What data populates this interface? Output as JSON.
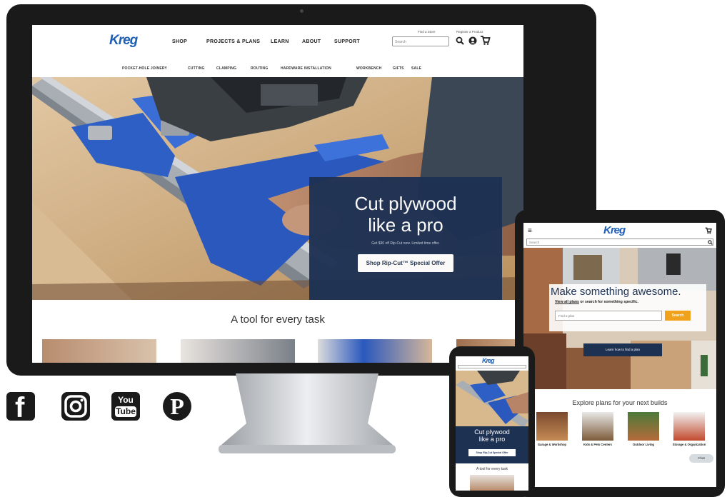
{
  "desktop": {
    "logo": "Kreg",
    "nav": [
      "SHOP",
      "PROJECTS & PLANS",
      "LEARN",
      "ABOUT",
      "SUPPORT"
    ],
    "util_links": [
      "Find a Store",
      "Register a Product"
    ],
    "search_placeholder": "Search",
    "subnav": [
      "POCKET-HOLE JOINERY",
      "CUTTING",
      "CLAMPING",
      "ROUTING",
      "HARDWARE INSTALLATION",
      "WORKBENCH",
      "GIFTS",
      "SALE"
    ],
    "hero_title_line1": "Cut plywood",
    "hero_title_line2": "like a pro",
    "hero_sub": "Get $30 off Rip-Cut now. Limited time offer.",
    "hero_button": "Shop Rip-Cut™ Special Offer",
    "section_title": "A tool for every task"
  },
  "tablet": {
    "logo": "Kreg",
    "search_placeholder": "Search",
    "headline": "Make something awesome.",
    "subline_link": "View all plans",
    "subline_rest": " or search for something specific.",
    "input_placeholder": "Find a plan",
    "search_button": "Search",
    "banner_button": "Learn how to find a plan",
    "explore_title": "Explore plans for your next builds",
    "categories": [
      "Garage & Workshop",
      "Kids & Pets Centers",
      "Outdoor Living",
      "Storage & Organization"
    ],
    "chat_label": "Chat"
  },
  "phone": {
    "logo": "Kreg",
    "title_line1": "Cut plywood",
    "title_line2": "like a pro",
    "button": "Shop Rip-Cut Special Offer",
    "section_title": "A tool for every task"
  },
  "social": {
    "icons": [
      "facebook-icon",
      "instagram-icon",
      "youtube-icon",
      "pinterest-icon"
    ],
    "youtube_top": "You",
    "youtube_bottom": "Tube",
    "facebook_glyph": "f",
    "pinterest_glyph": "P"
  },
  "colors": {
    "brand_blue": "#1f5fb4",
    "navy_promo": "#1d3153",
    "device_black": "#1a1a1a",
    "orange_button": "#f0a21c"
  }
}
